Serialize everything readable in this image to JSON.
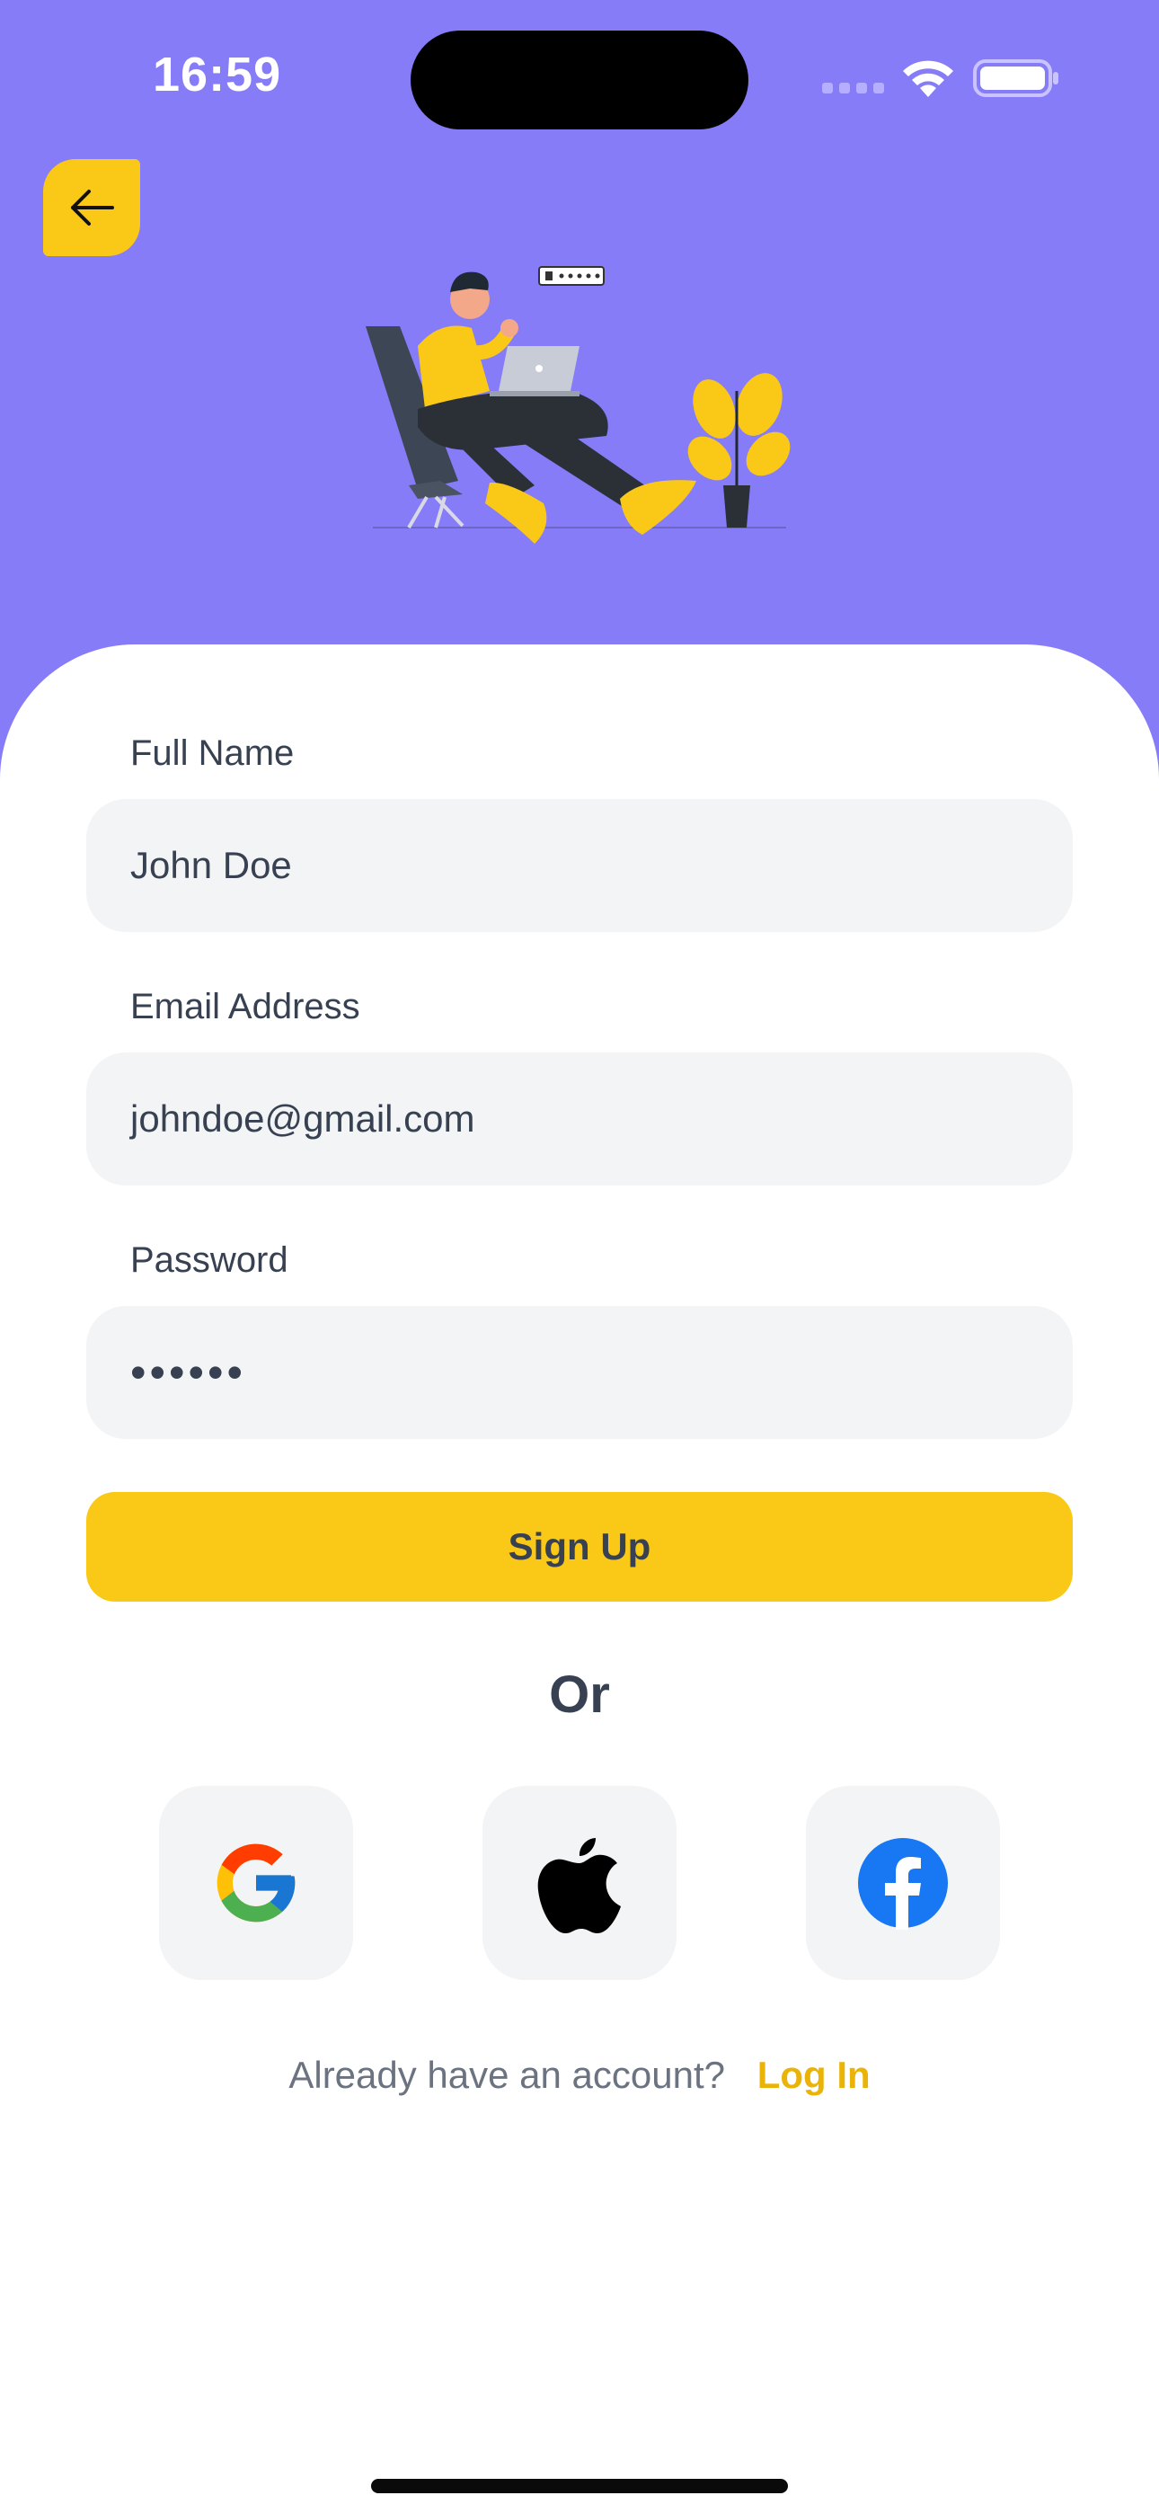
{
  "status_bar": {
    "time": "16:59"
  },
  "form": {
    "full_name": {
      "label": "Full Name",
      "value": "John Doe"
    },
    "email": {
      "label": "Email Address",
      "value": "johndoe@gmail.com"
    },
    "password": {
      "label": "Password",
      "value": "••••••"
    }
  },
  "signup_label": "Sign Up",
  "divider_text": "Or",
  "social": {
    "google": "google-icon",
    "apple": "apple-icon",
    "facebook": "facebook-icon"
  },
  "footer": {
    "question": "Already have an account?",
    "login_link": "Log In"
  },
  "colors": {
    "header_bg": "#877cf8",
    "accent": "#fac918",
    "field_bg": "#f3f4f6",
    "text": "#374151",
    "link": "#eab308"
  }
}
